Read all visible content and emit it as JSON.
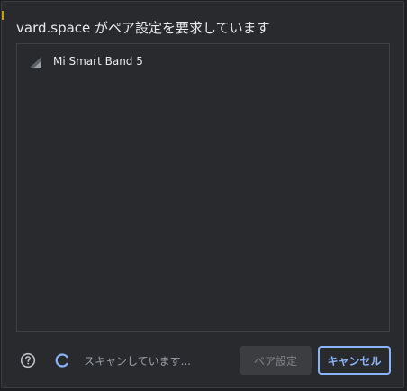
{
  "dialog": {
    "title": "vard.space がペア設定を要求しています"
  },
  "devices": [
    {
      "name": "Mi Smart Band 5",
      "icon": "signal-strength-icon"
    }
  ],
  "footer": {
    "help_icon": "help-icon",
    "spinner_icon": "spinner-icon",
    "status": "スキャンしています...",
    "pair_label": "ペア設定",
    "cancel_label": "キャンセル"
  },
  "colors": {
    "background": "#292a2d",
    "accent": "#8ab4f8",
    "text": "#e8eaed",
    "muted_text": "#9aa0a6"
  }
}
